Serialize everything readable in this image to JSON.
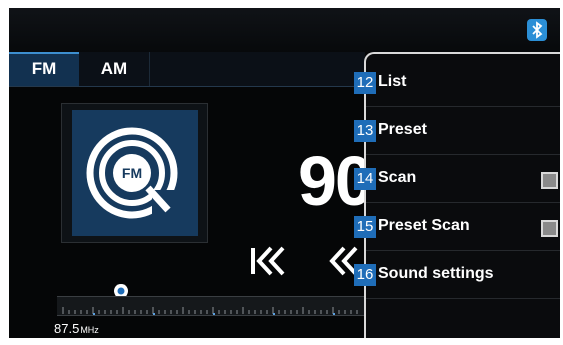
{
  "status": {
    "bluetooth_icon": "bluetooth-icon",
    "accent": "#2b8fd6"
  },
  "tabs": [
    {
      "label": "FM"
    },
    {
      "label": "AM"
    }
  ],
  "station": {
    "frequency_big": "90",
    "frequency": "87.5",
    "unit": "MHz",
    "album_icon": "fm-radio-icon"
  },
  "controls": {
    "prev_icon": "double-chevron-left-icon",
    "seek_icon": "double-chevron-left-icon"
  },
  "menu": {
    "items": [
      {
        "number": "12",
        "label": "List",
        "checkbox": false
      },
      {
        "number": "13",
        "label": "Preset",
        "checkbox": false
      },
      {
        "number": "14",
        "label": "Scan",
        "checkbox": true
      },
      {
        "number": "15",
        "label": "Preset Scan",
        "checkbox": true
      },
      {
        "number": "16",
        "label": "Sound settings",
        "checkbox": false
      }
    ]
  }
}
